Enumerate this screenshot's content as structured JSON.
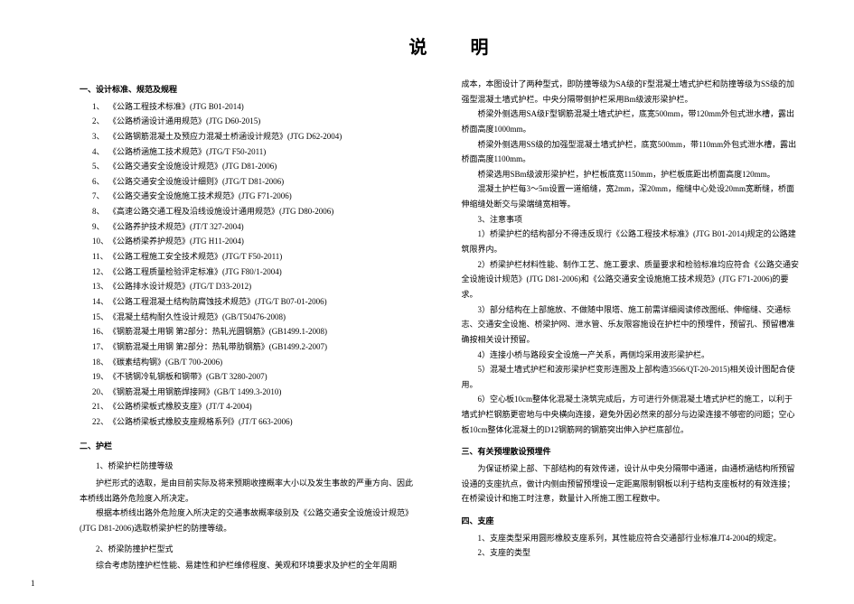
{
  "title": "说明",
  "pageNumber": "1",
  "left": {
    "section1": {
      "heading": "一、设计标准、规范及规程",
      "items": [
        "《公路工程技术标准》(JTG B01-2014)",
        "《公路桥涵设计通用规范》(JTG D60-2015)",
        "《公路钢筋混凝土及预应力混凝土桥涵设计规范》(JTG D62-2004)",
        "《公路桥涵施工技术规范》(JTG/T F50-2011)",
        "《公路交通安全设施设计规范》(JTG D81-2006)",
        "《公路交通安全设施设计细则》(JTG/T D81-2006)",
        "《公路交通安全设施施工技术规范》(JTG F71-2006)",
        "《高速公路交通工程及沿线设施设计通用规范》(JTG D80-2006)",
        "《公路养护技术规范》(JT/T 327-2004)",
        "《公路桥梁养护规范》(JTG H11-2004)",
        "《公路工程施工安全技术规范》(JTG/T F50-2011)",
        "《公路工程质量检验评定标准》(JTG F80/1-2004)",
        "《公路排水设计规范》(JTG/T D33-2012)",
        "《公路工程混凝土结构防腐蚀技术规范》(JTG/T B07-01-2006)",
        "《混凝土结构耐久性设计规范》(GB/T50476-2008)",
        "《钢筋混凝土用钢 第2部分：热轧光圆钢筋》(GB1499.1-2008)",
        "《钢筋混凝土用钢 第2部分：热轧带肋钢筋》(GB1499.2-2007)",
        "《碳素结构钢》(GB/T 700-2006)",
        "《不锈钢冷轧钢板和钢带》(GB/T 3280-2007)",
        "《钢筋混凝土用钢筋焊接网》(GB/T 1499.3-2010)",
        "《公路桥梁板式橡胶支座》(JT/T 4-2004)",
        "《公路桥梁板式橡胶支座规格系列》(JT/T 663-2006)"
      ]
    },
    "section2": {
      "heading": "二、护栏",
      "sub1_heading": "1、桥梁护栏防撞等级",
      "sub1_p1": "护栏形式的选取，是由目前实际及将来预期收撞概率大小以及发生事故的严重方向、因此本桥线出路外危险度入所决定。",
      "sub1_p2": "根据本桥线出路外危险度入所决定的交通事故概率级别及《公路交通安全设施设计规范》(JTG D81-2006)选取桥梁护栏的防撞等级。",
      "sub2_heading": "2、桥梁防撞护栏型式",
      "sub2_p1": "综合考虑防撞护栏性能、易建性和护栏维修程度、美观和环境要求及护栏的全年周期"
    }
  },
  "right": {
    "p1": "成本，本图设计了两种型式，即防撞等级为SA级的F型混凝土墙式护栏和防撞等级为SS级的加强型混凝土墙式护栏。中央分隔带侧护栏采用Bm级波形梁护栏。",
    "p2": "桥梁外侧选用SA级F型钢筋混凝土墙式护栏，底宽500mm，带120mm外包式泄水槽，露出桥面高度1000mm。",
    "p3": "桥梁外侧选用SS级的加强型混凝土墙式护栏，底宽500mm，带110mm外包式泄水槽，露出桥面高度1100mm。",
    "p4": "桥梁选用SBm级波形梁护栏，护栏板底宽1150mm，护栏板底距出桥面高度120mm。",
    "p5": "混凝土护栏每3～5m设置一道缩缝，宽2mm，深20mm，缩缝中心处设20mm宽断缝，桥面伸缩缝处断交与梁端缝宽相等。",
    "note_heading": "3、注意事项",
    "n1": "1）桥梁护栏的结构部分不得违反现行《公路工程技术标准》(JTG B01-2014)规定的公路建筑限界内。",
    "n2": "2）桥梁护栏材料性能、制作工艺、施工要求、质量要求和检验标准均应符合《公路交通安全设施设计规范》(JTG D81-2006)和《公路交通安全设施施工技术规范》(JTG F71-2006)的要求。",
    "n3": "3）部分结构在上部施放、不做随中限塔、施工前需详细阅读修改图纸、伸缩缝、交通标志、交通安全设施、桥梁护网、泄水管、乐友限容施设在护栏中的预埋件，预留孔、预留槽准确按相关设计预留。",
    "n4": "4）连接小桥与路段安全设施一产关系，两侧均采用波形梁护栏。",
    "n5": "5）混凝土墙式护栏和波形梁护栏变形连图及上部构造3566/QT-20-2015)相关设计图配合使用。",
    "n6": "6）空心板10cm整体化混凝土浇筑完成后，方可进行外侧混凝土墙式护栏的施工，以利于墙式护栏钢筋更密地与中央横向连接，避免外因必然来的部分与边梁连接不够密的问题；空心板10cm整体化混凝土的D12钢筋网的钢筋突出伸入护栏底部位。",
    "section3_heading": "三、有关预埋散设预埋件",
    "s3_p1": "为保证桥梁上部、下部结构的有效传递，设计从中央分隔带中通道，由通桥涵结构所预留设通的支座抗点，做计内侧由预留预埋设一定距离限制钢板以利于结构支座板材的有效连接；在桥梁设计和施工时注意，数量计入所施工图工程数中。",
    "section4_heading": "四、支座",
    "s4_1": "1、支座类型采用圆形橡胶支座系列，其性能应符合交通部行业标准JT4-2004的规定。",
    "s4_2": "2、支座的类型"
  }
}
